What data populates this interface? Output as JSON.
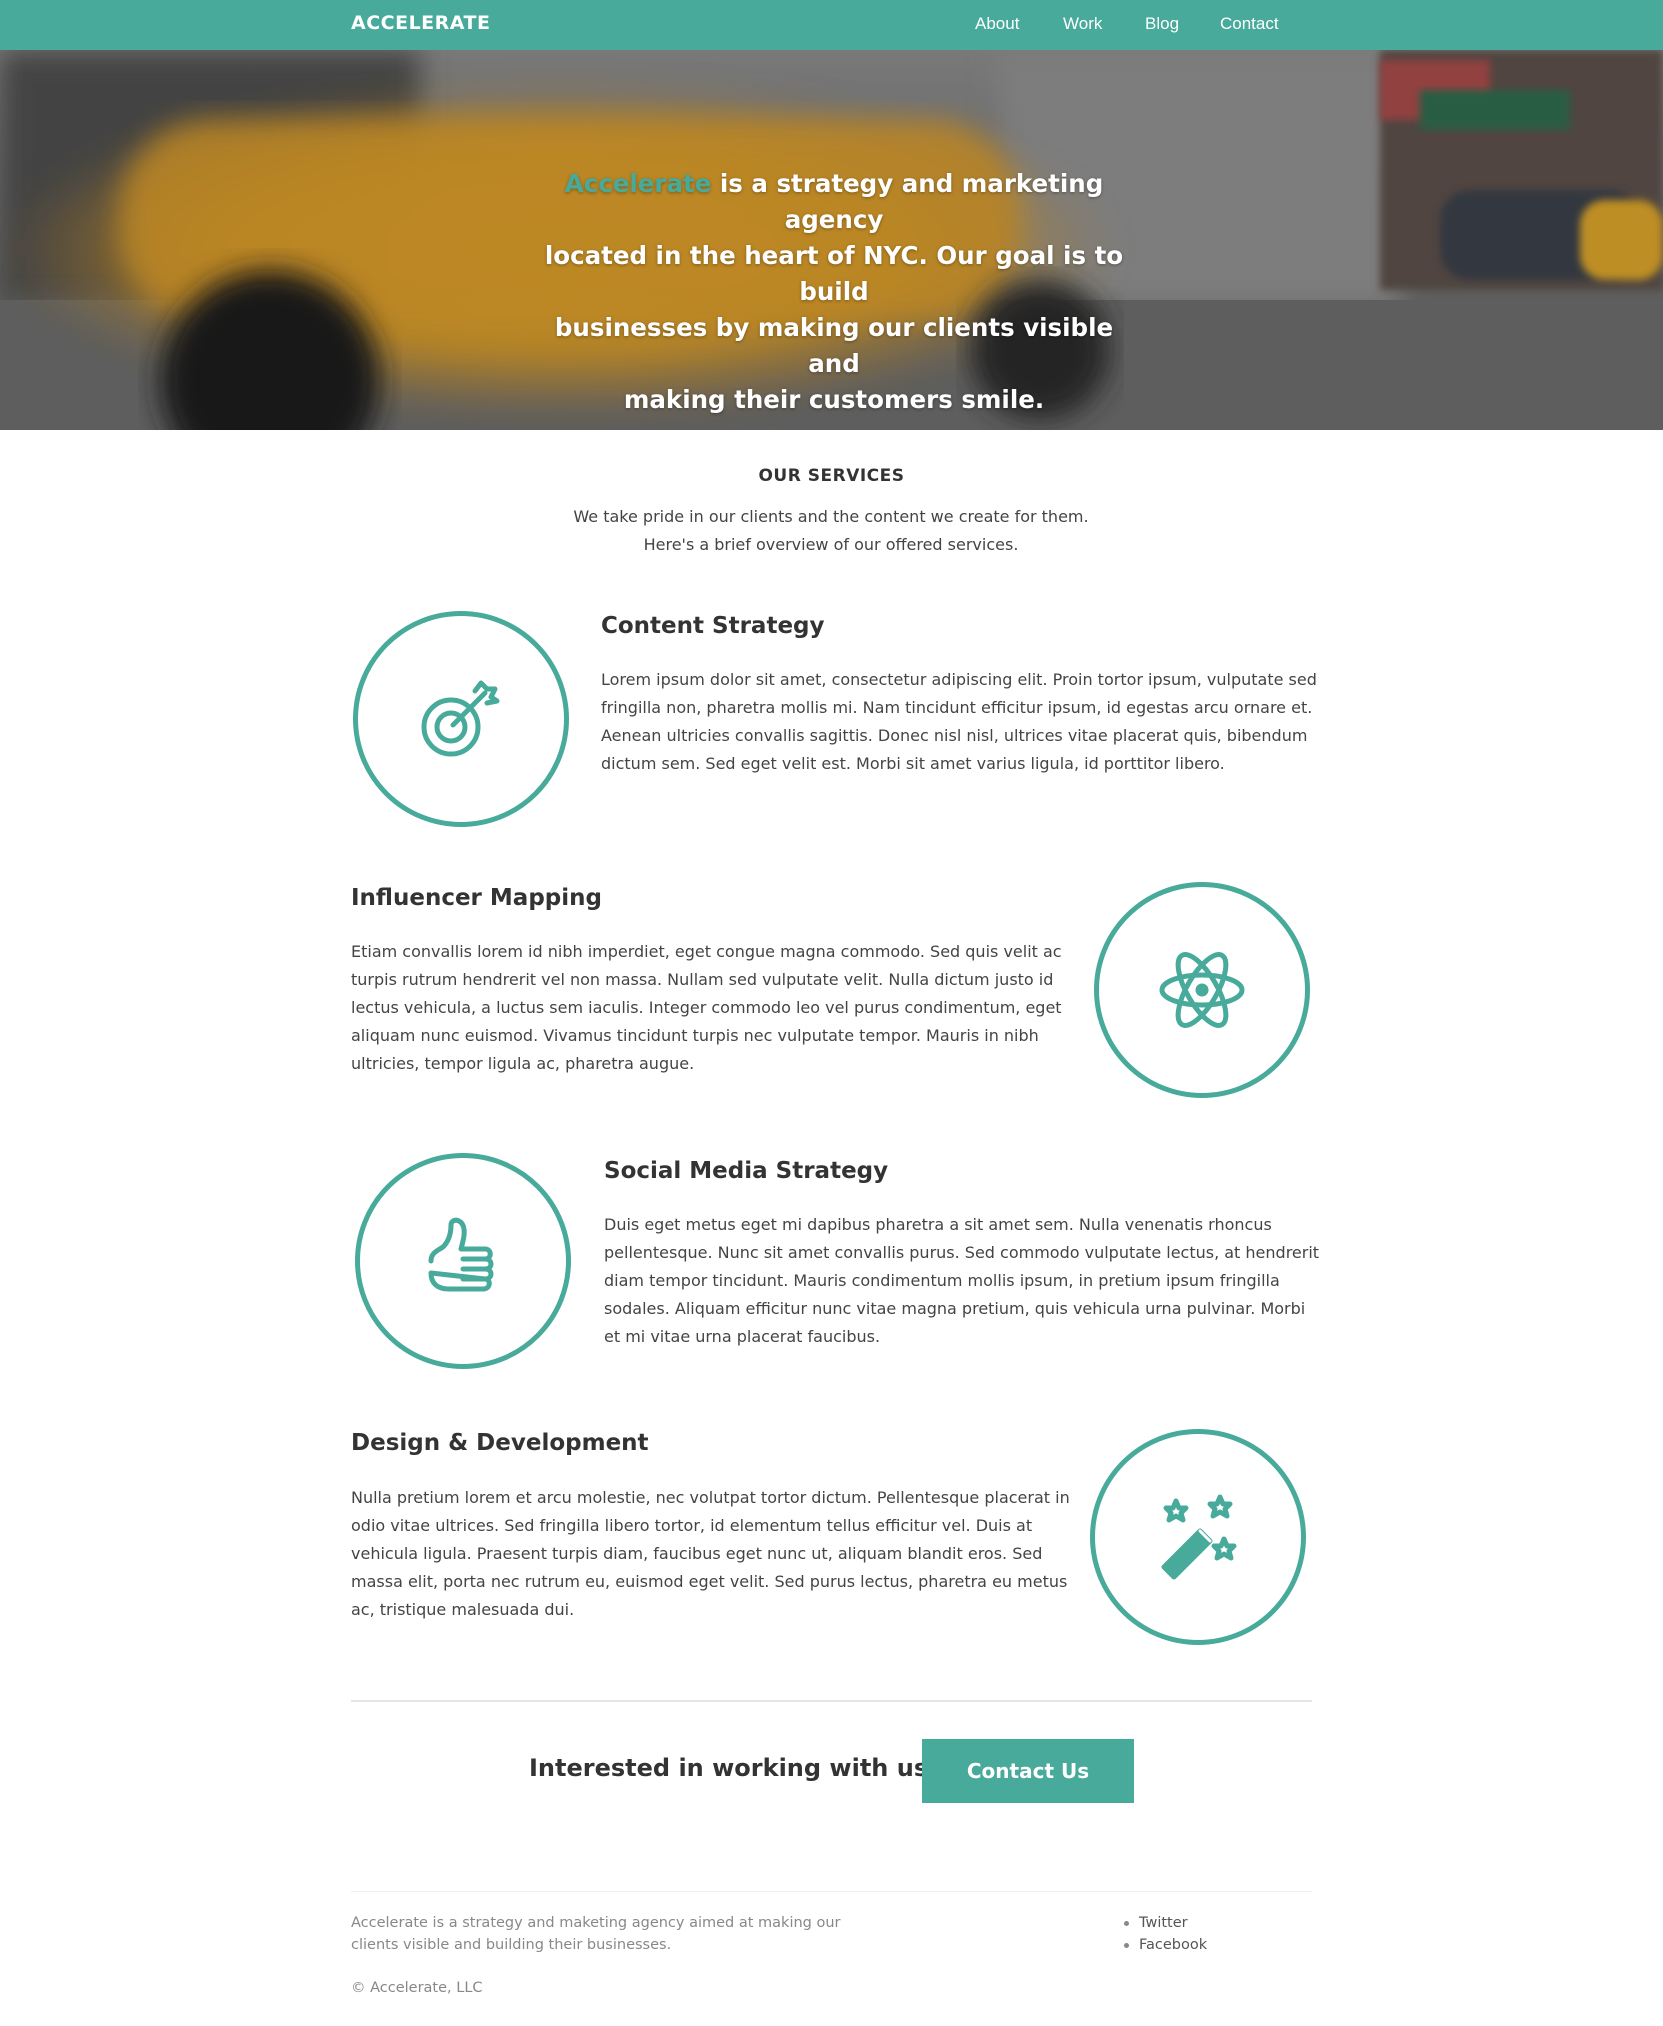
{
  "header": {
    "brand": "ACCELERATE",
    "nav": [
      {
        "label": "About"
      },
      {
        "label": "Work"
      },
      {
        "label": "Blog"
      },
      {
        "label": "Contact"
      }
    ]
  },
  "hero": {
    "accent_word": "Accelerate",
    "text_line1_rest": " is a strategy and marketing agency",
    "text_line2": "located in the heart of NYC. Our goal is to build",
    "text_line3": "businesses by making our clients visible and",
    "text_line4": "making their customers smile."
  },
  "services": {
    "title": "OUR SERVICES",
    "intro_line1": "We take pride in our clients and the content we create for them.",
    "intro_line2": "Here's a brief overview of our offered services.",
    "items": [
      {
        "icon": "target-icon",
        "title": "Content Strategy",
        "lines": [
          "Lorem ipsum dolor sit amet, consectetur adipiscing elit. Proin tortor ipsum, vulputate sed",
          "fringilla non, pharetra mollis mi. Nam tincidunt efficitur ipsum, id egestas arcu ornare et.",
          "Aenean ultricies convallis sagittis. Donec nisl nisl, ultrices vitae placerat quis, bibendum",
          "dictum sem. Sed eget velit est. Morbi sit amet varius ligula, id porttitor libero."
        ]
      },
      {
        "icon": "atom-icon",
        "title": "Influencer Mapping",
        "lines": [
          "Etiam convallis lorem id nibh imperdiet, eget congue magna commodo. Sed quis velit ac",
          "turpis rutrum hendrerit vel non massa. Nullam sed vulputate velit. Nulla dictum justo id",
          "lectus vehicula, a luctus sem iaculis. Integer commodo leo vel purus condimentum, eget",
          "aliquam nunc euismod. Vivamus tincidunt turpis nec vulputate tempor. Mauris in nibh",
          "ultricies, tempor ligula ac, pharetra augue."
        ]
      },
      {
        "icon": "thumbs-up-icon",
        "title": "Social Media Strategy",
        "lines": [
          "Duis eget metus eget mi dapibus pharetra a sit amet sem. Nulla venenatis rhoncus",
          "pellentesque. Nunc sit amet convallis purus. Sed commodo vulputate lectus, at hendrerit",
          "diam tempor tincidunt. Mauris condimentum mollis ipsum, in pretium ipsum fringilla",
          "sodales. Aliquam efficitur nunc vitae magna pretium, quis vehicula urna pulvinar. Morbi",
          "et mi vitae urna placerat faucibus."
        ]
      },
      {
        "icon": "magic-wand-icon",
        "title": "Design & Development",
        "lines": [
          "Nulla pretium lorem et arcu molestie, nec volutpat tortor dictum. Pellentesque placerat in",
          "odio vitae ultrices. Sed fringilla libero tortor, id elementum tellus efficitur vel. Duis at",
          "vehicula ligula. Praesent turpis diam, faucibus eget nunc ut, aliquam blandit eros. Sed",
          "massa elit, porta nec rutrum eu, euismod eget velit. Sed purus lectus, pharetra eu metus",
          "ac, tristique malesuada dui."
        ]
      }
    ]
  },
  "cta": {
    "question": "Interested in working with us?",
    "button_label": "Contact Us"
  },
  "footer": {
    "about_line1": "Accelerate is a strategy and maketing agency aimed at making our",
    "about_line2": "clients visible and building their businesses.",
    "links": [
      {
        "label": "Twitter"
      },
      {
        "label": "Facebook"
      }
    ],
    "copyright": "© Accelerate, LLC"
  },
  "colors": {
    "accent": "#47aa9b",
    "text": "#333333",
    "muted": "#888888"
  }
}
